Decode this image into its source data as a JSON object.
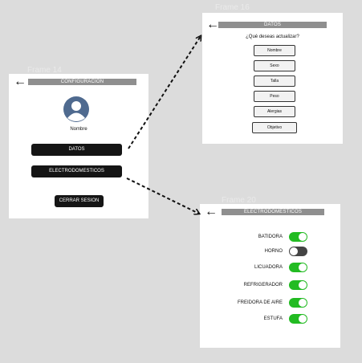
{
  "frame_labels": [
    "Frame 14",
    "Frame 16",
    "Frame 20"
  ],
  "config_screen": {
    "back_icon": "←",
    "title": "CONFIGURACIÓN",
    "user_name": "Nombre",
    "datos_button": "DATOS",
    "electro_button": "ELECTRODOMESTICOS",
    "logout_button": "CERRAR SESION"
  },
  "datos_screen": {
    "back_icon": "←",
    "title": "DATOS",
    "question": "¿Qué deseas actualizar?",
    "options": [
      "Nombre",
      "Sexo",
      "Talla",
      "Peso",
      "Alergias",
      "Objetivo"
    ]
  },
  "electro_screen": {
    "back_icon": "←",
    "title": "ELECTRODOMESTICOS",
    "appliances": [
      {
        "label": "BATIDORA",
        "state": "on"
      },
      {
        "label": "HORNO",
        "state": "off"
      },
      {
        "label": "LICUADORA",
        "state": "on"
      },
      {
        "label": "REFRIGERADOR",
        "state": "on"
      },
      {
        "label": "FREIDORA DE AIRE",
        "state": "on"
      },
      {
        "label": "ESTUFA",
        "state": "on"
      }
    ]
  },
  "colors": {
    "toggle_on": "#22bb22",
    "toggle_off": "#444444",
    "header_bar": "#8f8f8f",
    "dark_button": "#151515"
  }
}
